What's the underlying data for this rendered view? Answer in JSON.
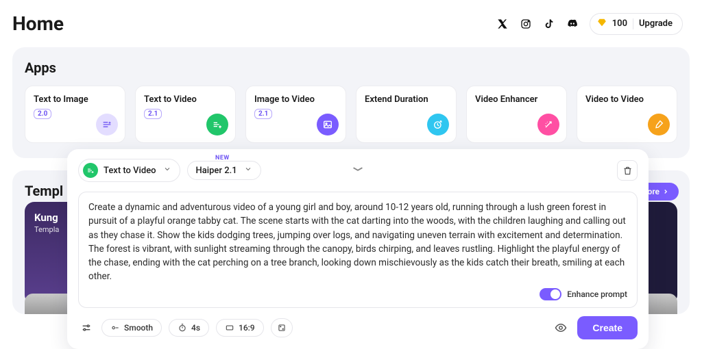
{
  "header": {
    "title": "Home",
    "credits": "100",
    "upgrade_label": "Upgrade"
  },
  "apps": {
    "title": "Apps",
    "items": [
      {
        "name": "Text to Image",
        "badge": "2.0"
      },
      {
        "name": "Text to Video",
        "badge": "2.1"
      },
      {
        "name": "Image to Video",
        "badge": "2.1"
      },
      {
        "name": "Extend Duration",
        "badge": ""
      },
      {
        "name": "Video Enhancer",
        "badge": ""
      },
      {
        "name": "Video to Video",
        "badge": ""
      }
    ]
  },
  "templates": {
    "title": "Templ",
    "explore_label": "lore",
    "card": {
      "name": "Kung",
      "sub": "Templa"
    }
  },
  "composer": {
    "mode_label": "Text to Video",
    "model_label": "Haiper 2.1",
    "new_tag": "NEW",
    "prompt": "Create a dynamic and adventurous video of a young girl and boy, around 10-12 years old, running through a lush green forest in pursuit of a playful orange tabby cat. The scene starts with the cat darting into the woods, with the children laughing and calling out as they chase it. Show the kids dodging trees, jumping over logs, and navigating uneven terrain with excitement and determination. The forest is vibrant, with sunlight streaming through the canopy, birds chirping, and leaves rustling. Highlight the playful energy of the chase, ending with the cat perching on a tree branch, looking down mischievously as the kids catch their breath, smiling at each other.",
    "enhance_label": "Enhance prompt",
    "motion_label": "Smooth",
    "duration_label": "4s",
    "aspect_label": "16:9",
    "create_label": "Create"
  }
}
